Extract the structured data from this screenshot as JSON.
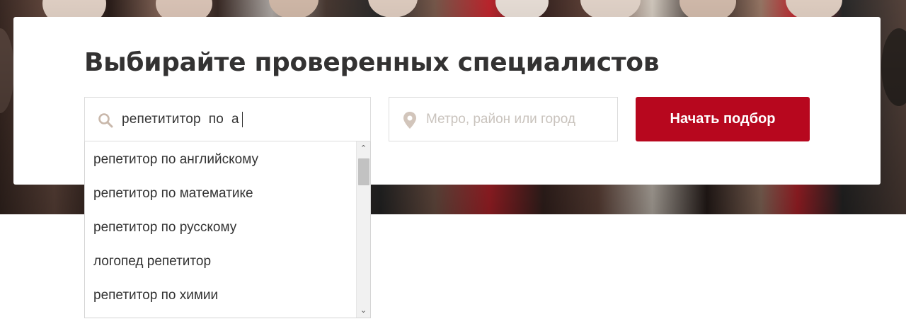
{
  "header": {
    "title": "Выбирайте проверенных специалистов"
  },
  "search": {
    "value": "репетититор  по  а",
    "icon": "search-icon"
  },
  "location": {
    "placeholder": "Метро, район или город",
    "icon": "location-pin-icon"
  },
  "actions": {
    "start_label": "Начать подбор"
  },
  "suggestions": [
    "репетитор по английскому",
    "репетитор по математике",
    "репетитор по русскому",
    "логопед репетитор",
    "репетитор по химии"
  ],
  "scrollbar": {
    "up_icon": "scroll-up-arrow-icon",
    "down_icon": "scroll-down-arrow-icon"
  },
  "colors": {
    "accent": "#b7071e",
    "text": "#333232",
    "placeholder": "#c9c3bd",
    "icon": "#c9b8ab"
  }
}
